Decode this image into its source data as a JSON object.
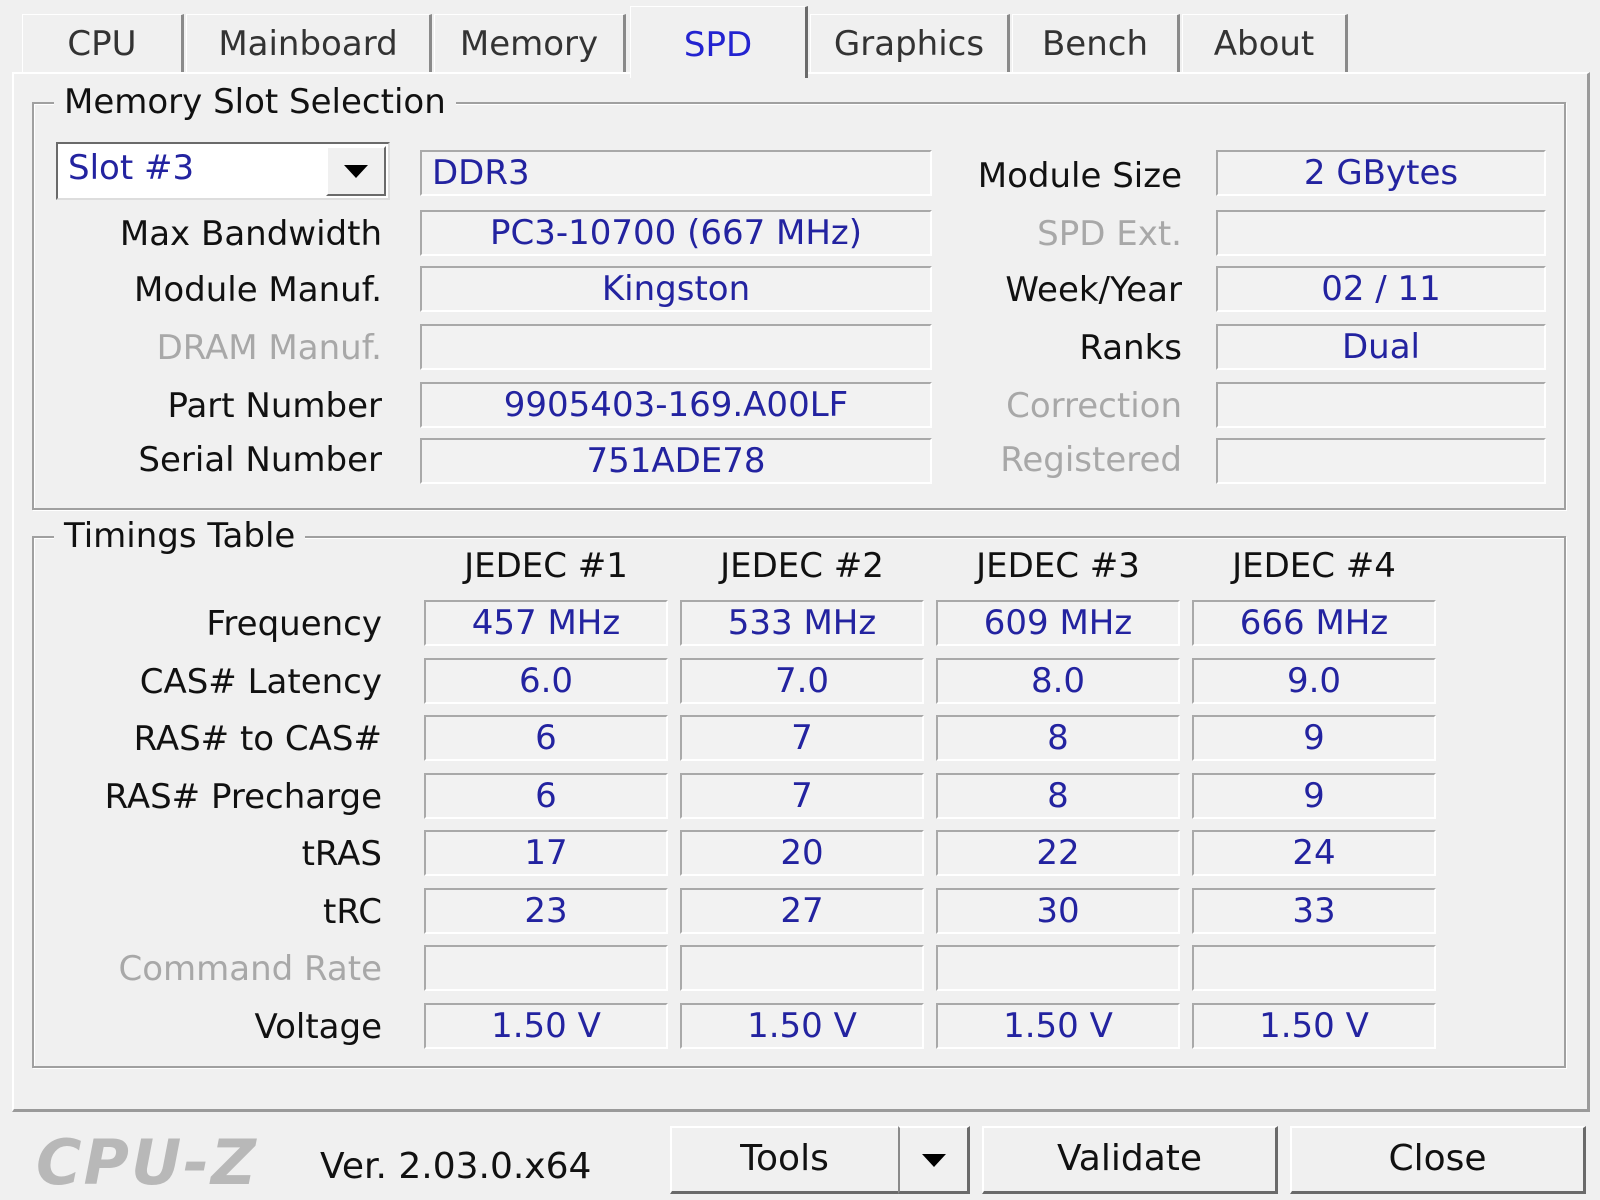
{
  "tabs": [
    "CPU",
    "Mainboard",
    "Memory",
    "SPD",
    "Graphics",
    "Bench",
    "About"
  ],
  "active_tab": "SPD",
  "memory_slot": {
    "legend": "Memory Slot Selection",
    "slot_selected": "Slot #3",
    "type": "DDR3",
    "labels": {
      "module_size": "Module Size",
      "max_bandwidth": "Max Bandwidth",
      "spd_ext": "SPD Ext.",
      "module_manuf": "Module Manuf.",
      "week_year": "Week/Year",
      "dram_manuf": "DRAM Manuf.",
      "ranks": "Ranks",
      "part_number": "Part Number",
      "correction": "Correction",
      "serial_number": "Serial Number",
      "registered": "Registered"
    },
    "values": {
      "module_size": "2 GBytes",
      "max_bandwidth": "PC3-10700 (667 MHz)",
      "spd_ext": "",
      "module_manuf": "Kingston",
      "week_year": "02 / 11",
      "dram_manuf": "",
      "ranks": "Dual",
      "part_number": "9905403-169.A00LF",
      "correction": "",
      "serial_number": "751ADE78",
      "registered": ""
    }
  },
  "timings": {
    "legend": "Timings Table",
    "columns": [
      "JEDEC #1",
      "JEDEC #2",
      "JEDEC #3",
      "JEDEC #4"
    ],
    "rows": [
      {
        "label": "Frequency",
        "values": [
          "457 MHz",
          "533 MHz",
          "609 MHz",
          "666 MHz"
        ]
      },
      {
        "label": "CAS# Latency",
        "values": [
          "6.0",
          "7.0",
          "8.0",
          "9.0"
        ]
      },
      {
        "label": "RAS# to CAS#",
        "values": [
          "6",
          "7",
          "8",
          "9"
        ]
      },
      {
        "label": "RAS# Precharge",
        "values": [
          "6",
          "7",
          "8",
          "9"
        ]
      },
      {
        "label": "tRAS",
        "values": [
          "17",
          "20",
          "22",
          "24"
        ]
      },
      {
        "label": "tRC",
        "values": [
          "23",
          "27",
          "30",
          "33"
        ]
      },
      {
        "label": "Command Rate",
        "values": [
          "",
          "",
          "",
          ""
        ]
      },
      {
        "label": "Voltage",
        "values": [
          "1.50 V",
          "1.50 V",
          "1.50 V",
          "1.50 V"
        ]
      }
    ]
  },
  "footer": {
    "logo": "CPU-Z",
    "version": "Ver. 2.03.0.x64",
    "tools": "Tools",
    "validate": "Validate",
    "close": "Close"
  }
}
